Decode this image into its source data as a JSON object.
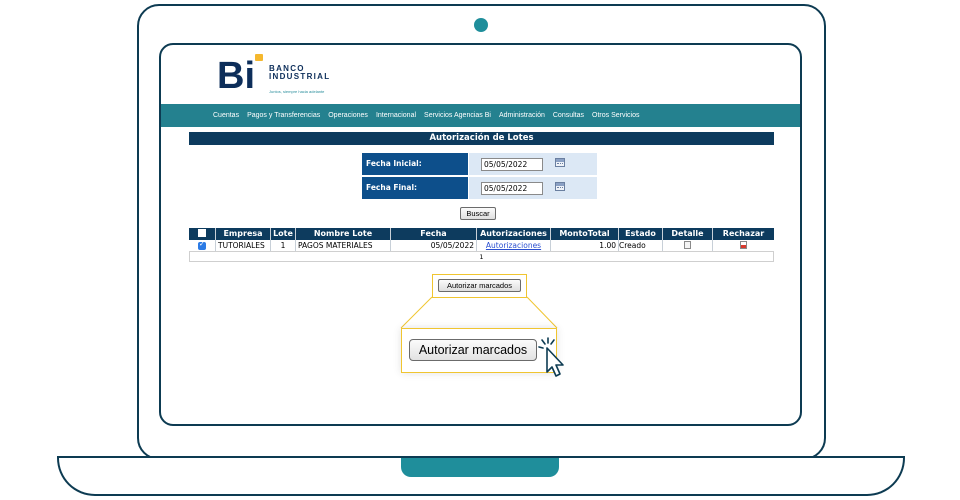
{
  "bank": {
    "logo_initials": "Bi",
    "name_line1": "BANCO",
    "name_line2": "INDUSTRIAL",
    "tagline": "Juntos, siempre hacia adelante"
  },
  "nav": {
    "items": [
      "Cuentas",
      "Pagos y Transferencias",
      "Operaciones",
      "Internacional",
      "Servicios Agencias Bi",
      "Administración",
      "Consultas",
      "Otros Servicios"
    ]
  },
  "page": {
    "title": "Autorización de Lotes"
  },
  "form": {
    "start_label": "Fecha Inicial:",
    "start_value": "05/05/2022",
    "end_label": "Fecha Final:",
    "end_value": "05/05/2022",
    "search_button": "Buscar"
  },
  "table": {
    "headers": [
      "",
      "Empresa",
      "Lote",
      "Nombre Lote",
      "Fecha",
      "Autorizaciones",
      "MontoTotal",
      "Estado",
      "Detalle",
      "Rechazar"
    ],
    "rows": [
      {
        "checked": true,
        "empresa": "TUTORIALES",
        "lote": "1",
        "nombre": "PAGOS MATERIALES",
        "fecha": "05/05/2022",
        "autorizaciones": "Autorizaciones",
        "monto": "1.00",
        "estado": "Creado"
      }
    ],
    "pager": "1"
  },
  "actions": {
    "authorize_button": "Autorizar marcados",
    "authorize_button_zoom": "Autorizar marcados"
  },
  "colors": {
    "frame": "#0d3b52",
    "accent_teal": "#1f8e9b",
    "navbar": "#24818f",
    "header_navy": "#0d3b5e",
    "label_blue": "#0d4f8b",
    "highlight": "#f0c530",
    "logo_yellow": "#f5b82e"
  }
}
